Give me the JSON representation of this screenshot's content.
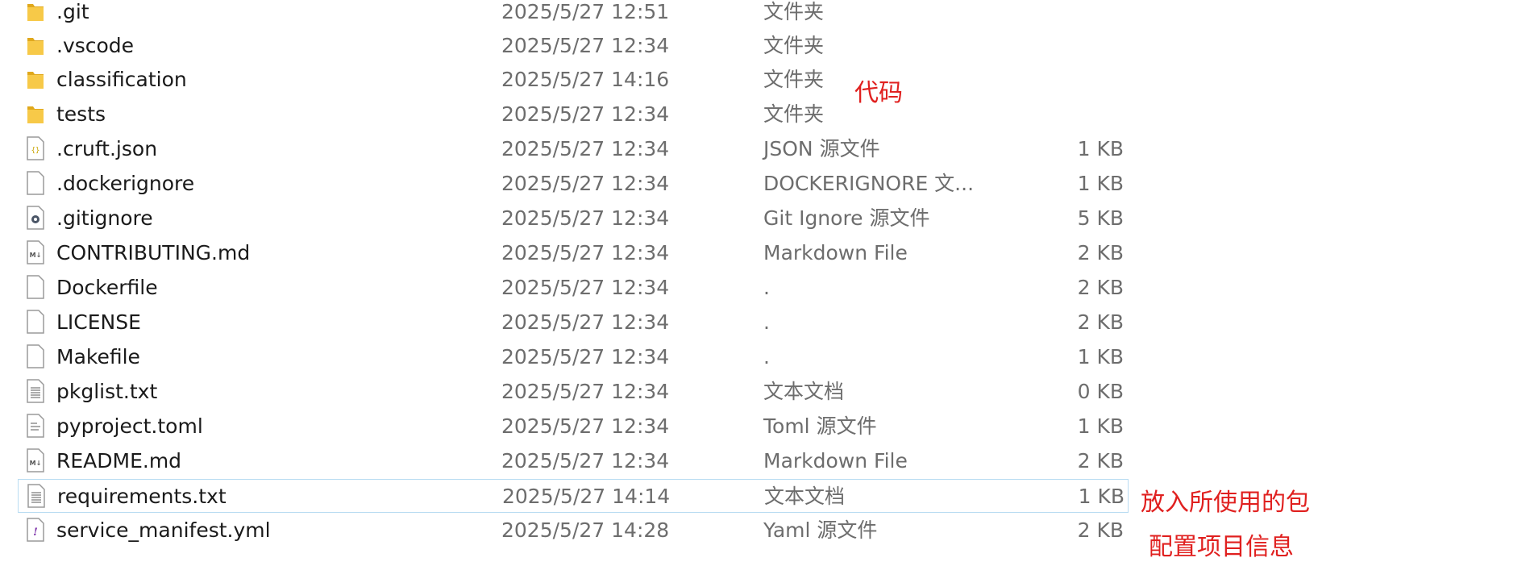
{
  "files": [
    {
      "name": ".git",
      "date": "2025/5/27 12:51",
      "type": "文件夹",
      "size": "",
      "icon": "folder-icon"
    },
    {
      "name": ".vscode",
      "date": "2025/5/27 12:34",
      "type": "文件夹",
      "size": "",
      "icon": "folder-icon"
    },
    {
      "name": "classification",
      "date": "2025/5/27 14:16",
      "type": "文件夹",
      "size": "",
      "icon": "folder-icon"
    },
    {
      "name": "tests",
      "date": "2025/5/27 12:34",
      "type": "文件夹",
      "size": "",
      "icon": "folder-icon"
    },
    {
      "name": ".cruft.json",
      "date": "2025/5/27 12:34",
      "type": "JSON 源文件",
      "size": "1 KB",
      "icon": "json-file-icon"
    },
    {
      "name": ".dockerignore",
      "date": "2025/5/27 12:34",
      "type": "DOCKERIGNORE 文...",
      "size": "1 KB",
      "icon": "blank-file-icon"
    },
    {
      "name": ".gitignore",
      "date": "2025/5/27 12:34",
      "type": "Git Ignore 源文件",
      "size": "5 KB",
      "icon": "gear-file-icon"
    },
    {
      "name": "CONTRIBUTING.md",
      "date": "2025/5/27 12:34",
      "type": "Markdown File",
      "size": "2 KB",
      "icon": "markdown-file-icon"
    },
    {
      "name": "Dockerfile",
      "date": "2025/5/27 12:34",
      "type": ".",
      "size": "2 KB",
      "icon": "blank-file-icon"
    },
    {
      "name": "LICENSE",
      "date": "2025/5/27 12:34",
      "type": ".",
      "size": "2 KB",
      "icon": "blank-file-icon"
    },
    {
      "name": "Makefile",
      "date": "2025/5/27 12:34",
      "type": ".",
      "size": "1 KB",
      "icon": "blank-file-icon"
    },
    {
      "name": "pkglist.txt",
      "date": "2025/5/27 12:34",
      "type": "文本文档",
      "size": "0 KB",
      "icon": "text-file-icon"
    },
    {
      "name": "pyproject.toml",
      "date": "2025/5/27 12:34",
      "type": "Toml 源文件",
      "size": "1 KB",
      "icon": "lined-file-icon"
    },
    {
      "name": "README.md",
      "date": "2025/5/27 12:34",
      "type": "Markdown File",
      "size": "2 KB",
      "icon": "markdown-file-icon"
    },
    {
      "name": "requirements.txt",
      "date": "2025/5/27 14:14",
      "type": "文本文档",
      "size": "1 KB",
      "icon": "text-file-icon",
      "highlighted": true
    },
    {
      "name": "service_manifest.yml",
      "date": "2025/5/27 14:28",
      "type": "Yaml 源文件",
      "size": "2 KB",
      "icon": "yaml-file-icon"
    }
  ],
  "annotations": {
    "code": "代码",
    "packages": "放入所使用的包",
    "config": "配置项目信息"
  },
  "colors": {
    "annotation": "#e0201f",
    "folder": "#f4c542",
    "hover_border": "#b9dcf2",
    "secondary_text": "#6d6d6d"
  }
}
